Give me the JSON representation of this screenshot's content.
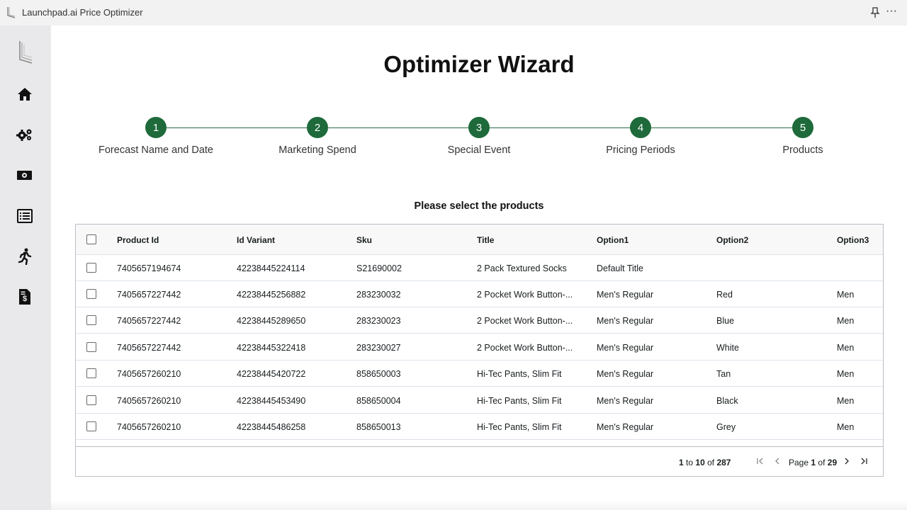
{
  "window": {
    "title": "Launchpad.ai Price Optimizer",
    "icons": {
      "app": "launchpad-logo-icon",
      "pin": "pin-icon",
      "more": "more-icon"
    },
    "more_glyph": "···"
  },
  "sidebar": {
    "items": [
      {
        "name": "logo",
        "icon": "launchpad-logo-icon"
      },
      {
        "name": "home",
        "icon": "home-icon"
      },
      {
        "name": "settings",
        "icon": "gears-icon"
      },
      {
        "name": "pricing",
        "icon": "money-icon"
      },
      {
        "name": "list",
        "icon": "list-icon"
      },
      {
        "name": "activity",
        "icon": "running-person-icon"
      },
      {
        "name": "invoice",
        "icon": "dollar-file-icon"
      }
    ]
  },
  "wizard": {
    "title": "Optimizer Wizard",
    "steps": [
      {
        "number": "1",
        "label": "Forecast Name and Date"
      },
      {
        "number": "2",
        "label": "Marketing Spend"
      },
      {
        "number": "3",
        "label": "Special Event"
      },
      {
        "number": "4",
        "label": "Pricing Periods"
      },
      {
        "number": "5",
        "label": "Products"
      }
    ],
    "accent_color": "#1e6a3a"
  },
  "products": {
    "heading": "Please select the products",
    "columns": [
      "Product Id",
      "Id Variant",
      "Sku",
      "Title",
      "Option1",
      "Option2",
      "Option3"
    ],
    "rows": [
      {
        "product_id": "7405657194674",
        "id_variant": "42238445224114",
        "sku": "S21690002",
        "title": "2 Pack Textured Socks",
        "option1": "Default Title",
        "option2": "",
        "option3": ""
      },
      {
        "product_id": "7405657227442",
        "id_variant": "42238445256882",
        "sku": "283230032",
        "title": "2 Pocket Work Button-...",
        "option1": "Men's Regular",
        "option2": "Red",
        "option3": "Men"
      },
      {
        "product_id": "7405657227442",
        "id_variant": "42238445289650",
        "sku": "283230023",
        "title": "2 Pocket Work Button-...",
        "option1": "Men's Regular",
        "option2": "Blue",
        "option3": "Men"
      },
      {
        "product_id": "7405657227442",
        "id_variant": "42238445322418",
        "sku": "283230027",
        "title": "2 Pocket Work Button-...",
        "option1": "Men's Regular",
        "option2": "White",
        "option3": "Men"
      },
      {
        "product_id": "7405657260210",
        "id_variant": "42238445420722",
        "sku": "858650003",
        "title": "Hi-Tec Pants, Slim Fit",
        "option1": "Men's Regular",
        "option2": "Tan",
        "option3": "Men"
      },
      {
        "product_id": "7405657260210",
        "id_variant": "42238445453490",
        "sku": "858650004",
        "title": "Hi-Tec Pants, Slim Fit",
        "option1": "Men's Regular",
        "option2": "Black",
        "option3": "Men"
      },
      {
        "product_id": "7405657260210",
        "id_variant": "42238445486258",
        "sku": "858650013",
        "title": "Hi-Tec Pants, Slim Fit",
        "option1": "Men's Regular",
        "option2": "Grey",
        "option3": "Men"
      }
    ],
    "pagination": {
      "from": "1",
      "to_word": "to",
      "to": "10",
      "of_word": "of",
      "total": "287",
      "page_word": "Page",
      "page": "1",
      "page_of_word": "of",
      "page_count": "29",
      "icons": {
        "first": "first-page-icon",
        "prev": "prev-page-icon",
        "next": "next-page-icon",
        "last": "last-page-icon"
      }
    }
  }
}
